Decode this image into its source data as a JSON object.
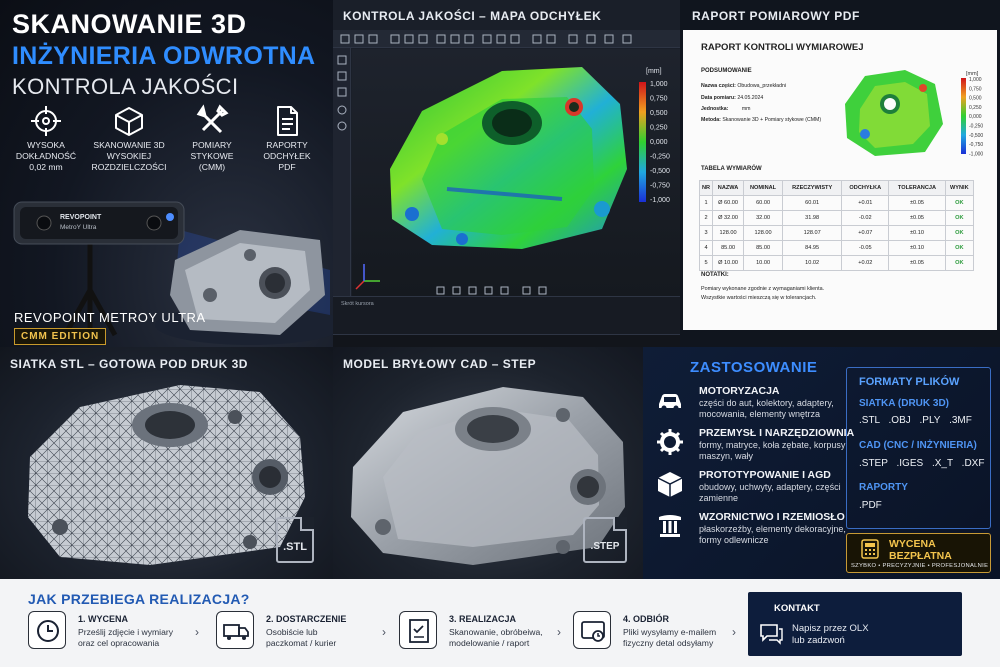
{
  "hero": {
    "title1": "SKANOWANIE 3D",
    "title2": "INŻYNIERIA ODWROTNA",
    "title3": "KONTROLA JAKOŚCI",
    "features": [
      {
        "icon": "crosshair-icon",
        "lines": [
          "WYSOKA",
          "DOKŁADNOŚĆ",
          "0,02 mm"
        ]
      },
      {
        "icon": "cube-icon",
        "lines": [
          "SKANOWANIE 3D",
          "WYSOKIEJ",
          "ROZDZIELCZOŚCI"
        ]
      },
      {
        "icon": "tools-icon",
        "lines": [
          "POMIARY",
          "STYKOWE",
          "(CMM)"
        ]
      },
      {
        "icon": "document-icon",
        "lines": [
          "RAPORTY",
          "ODCHYŁEK",
          "PDF"
        ]
      }
    ],
    "scanner_brand": "REVOPOINT",
    "scanner_model": "MetroY Ultra",
    "product": "REVOPOINT METROY ULTRA",
    "edition": "CMM EDITION"
  },
  "software": {
    "title": "KONTROLA JAKOŚCI – MAPA ODCHYŁEK",
    "unit": "[mm]",
    "scale": [
      "1,000",
      "0,750",
      "0,500",
      "0,250",
      "0,000",
      "-0,250",
      "-0,500",
      "-0,750",
      "-1,000"
    ],
    "status": "Skrót kursora"
  },
  "report": {
    "panel_title": "RAPORT POMIAROWY PDF",
    "doc_title": "RAPORT KONTROLI WYMIAROWEJ",
    "summary_h": "PODSUMOWANIE",
    "summary": [
      {
        "k": "Nazwa części:",
        "v": "Obudowa_przekładni"
      },
      {
        "k": "Data pomiaru:",
        "v": "24.05.2024"
      },
      {
        "k": "Jednostka:",
        "v": "mm"
      },
      {
        "k": "Metoda:",
        "v": "Skanowanie 3D + Pomiary stykowe (CMM)"
      }
    ],
    "unit": "[mm]",
    "scale": [
      "1,000",
      "0,750",
      "0,500",
      "0,250",
      "0,000",
      "-0,250",
      "-0,500",
      "-0,750",
      "-1,000"
    ],
    "table_h": "TABELA WYMIARÓW",
    "cols": [
      "NR",
      "NAZWA",
      "NOMINAL",
      "RZECZYWISTY",
      "ODCHYŁKA",
      "TOLERANCJA",
      "WYNIK"
    ],
    "rows": [
      [
        "1",
        "Ø 60.00",
        "60.00",
        "60.01",
        "+0.01",
        "±0.05",
        "OK"
      ],
      [
        "2",
        "Ø 32.00",
        "32.00",
        "31.98",
        "-0.02",
        "±0.05",
        "OK"
      ],
      [
        "3",
        "128.00",
        "128.00",
        "128.07",
        "+0.07",
        "±0.10",
        "OK"
      ],
      [
        "4",
        "85.00",
        "85.00",
        "84.95",
        "-0.05",
        "±0.10",
        "OK"
      ],
      [
        "5",
        "Ø 10.00",
        "10.00",
        "10.02",
        "+0.02",
        "±0.05",
        "OK"
      ]
    ],
    "notes_h": "NOTATKI:",
    "notes": [
      "Pomiary wykonane zgodnie z wymaganiami klienta.",
      "Wszystkie wartości mieszczą się w tolerancjach."
    ]
  },
  "stl": {
    "title": "SIATKA STL – GOTOWA POD DRUK 3D",
    "file": ".STL"
  },
  "step": {
    "title": "MODEL BRYŁOWY CAD – STEP",
    "file": ".STEP"
  },
  "apps": {
    "title": "ZASTOSOWANIE",
    "items": [
      {
        "icon": "car-icon",
        "title": "MOTORYZACJA",
        "desc": "części do aut, kolektory, adaptery, mocowania, elementy wnętrza"
      },
      {
        "icon": "gear-icon",
        "title": "PRZEMYSŁ I NARZĘDZIOWNIA",
        "desc": "formy, matryce, koła zębate, korpusy maszyn, wały"
      },
      {
        "icon": "box-icon",
        "title": "PROTOTYPOWANIE I AGD",
        "desc": "obudowy, uchwyty, adaptery, części zamienne"
      },
      {
        "icon": "column-icon",
        "title": "WZORNICTWO I RZEMIOSŁO",
        "desc": "płaskorzeźby, elementy dekoracyjne, formy odlewnicze"
      }
    ],
    "formats_title": "FORMATY PLIKÓW",
    "formats": [
      {
        "cat": "SIATKA (DRUK 3D)",
        "list": ".STL .OBJ .PLY .3MF"
      },
      {
        "cat": "CAD (CNC / INŻYNIERIA)",
        "list": ".STEP .IGES .X_T .DXF"
      },
      {
        "cat": "RAPORTY",
        "list": ".PDF"
      }
    ],
    "quote_title": "WYCENA BEZPŁATNA",
    "quote_sub": "SZYBKO • PRECYZYJNIE • PROFESJONALNIE"
  },
  "process": {
    "title": "JAK PRZEBIEGA REALIZACJA?",
    "steps": [
      {
        "icon": "clock-icon",
        "title": "1. WYCENA",
        "l1": "Prześlij zdjęcie i wymiary",
        "l2": "oraz cel opracowania"
      },
      {
        "icon": "truck-icon",
        "title": "2. DOSTARCZENIE",
        "l1": "Osobiście lub",
        "l2": "paczkomat / kurier"
      },
      {
        "icon": "checklist-icon",
        "title": "3. REALIZACJA",
        "l1": "Skanowanie, obróbeiwa,",
        "l2": "modelowanie / raport"
      },
      {
        "icon": "delivery-icon",
        "title": "4. ODBIÓR",
        "l1": "Pliki wysyłamy e-mailem",
        "l2": "fizyczny detal odsyłamy"
      }
    ],
    "contact_title": "KONTAKT",
    "contact_l1": "Napisz przez OLX",
    "contact_l2": "lub zadzwoń"
  },
  "colors": {
    "accent": "#2f8dff",
    "gold": "#f3c44d",
    "navy": "#0d1d3c"
  }
}
